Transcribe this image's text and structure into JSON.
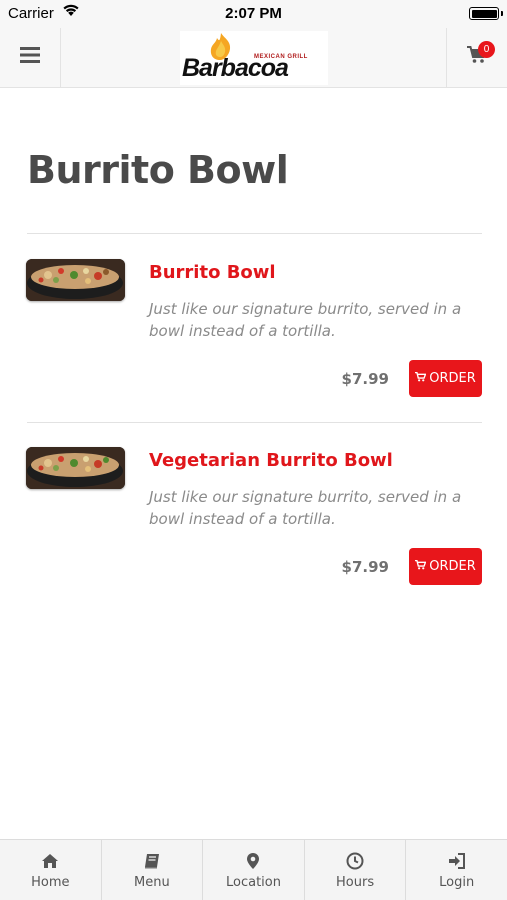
{
  "status_bar": {
    "carrier": "Carrier",
    "time": "2:07 PM"
  },
  "header": {
    "logo_text": "Barbacoa",
    "logo_subtitle": "MEXICAN GRILL",
    "cart_count": "0",
    "icons": {
      "menu": "hamburger-icon",
      "cart": "cart-icon"
    }
  },
  "page": {
    "title": "Burrito Bowl"
  },
  "items": [
    {
      "name": "Burrito Bowl",
      "description": "Just like our signature burrito, served in a bowl instead of a tortilla.",
      "price": "$7.99",
      "order_label": "ORDER"
    },
    {
      "name": "Vegetarian Burrito Bowl",
      "description": "Just like our signature burrito, served in a bowl instead of a tortilla.",
      "price": "$7.99",
      "order_label": "ORDER"
    }
  ],
  "tabs": [
    {
      "label": "Home",
      "icon": "home-icon"
    },
    {
      "label": "Menu",
      "icon": "book-icon"
    },
    {
      "label": "Location",
      "icon": "map-pin-icon"
    },
    {
      "label": "Hours",
      "icon": "clock-icon"
    },
    {
      "label": "Login",
      "icon": "sign-in-icon"
    }
  ],
  "colors": {
    "accent": "#e8161b",
    "title": "#4a4a4a",
    "tab_bg": "#f4f4f4"
  }
}
